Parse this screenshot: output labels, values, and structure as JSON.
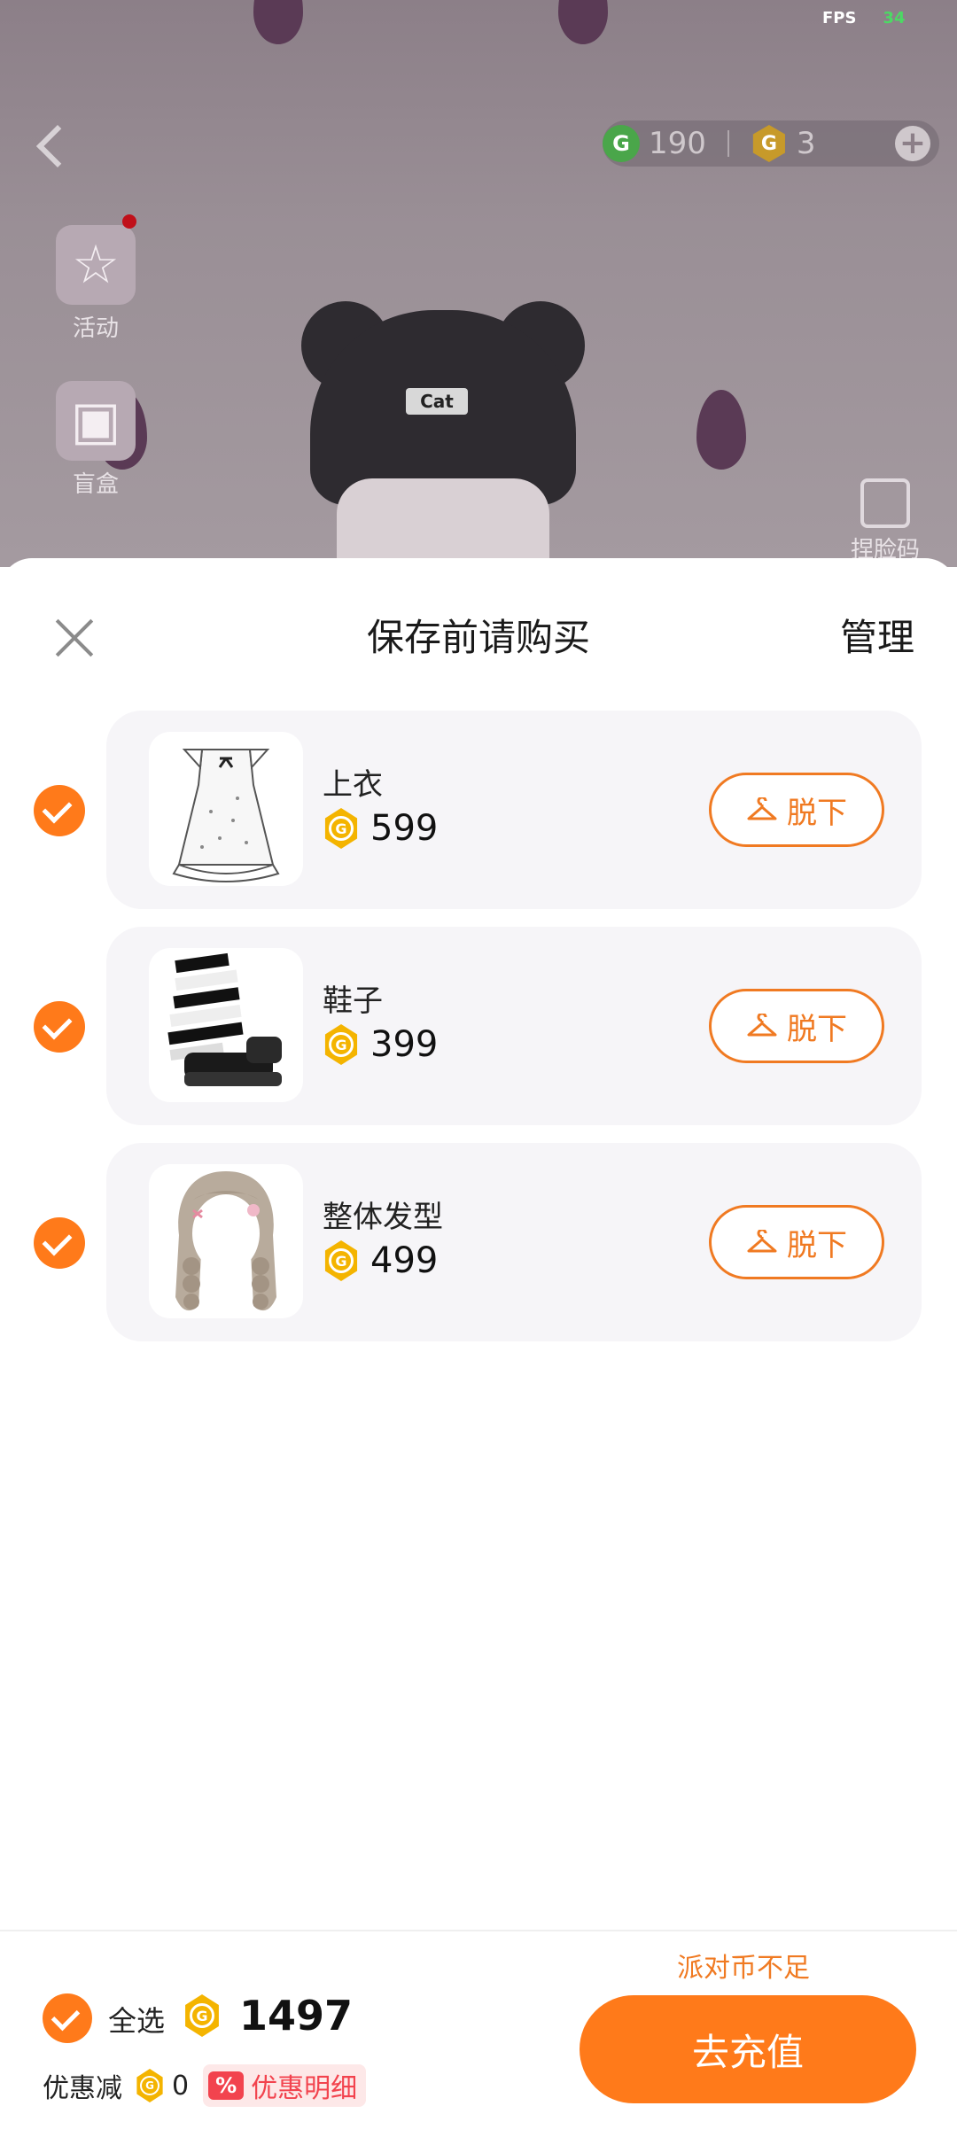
{
  "status": {
    "fps_label": "FPS",
    "fps_value": "34"
  },
  "scene": {
    "currency": {
      "green_amount": "190",
      "gold_amount": "3"
    },
    "side_menu": [
      {
        "label": "活动"
      },
      {
        "label": "盲盒"
      }
    ],
    "face_code_label": "捏脸码",
    "avatar_hat_text": "Cat"
  },
  "sheet": {
    "title": "保存前请购买",
    "manage_label": "管理",
    "items": [
      {
        "name": "上衣",
        "price": "599",
        "action": "脱下",
        "checked": true
      },
      {
        "name": "鞋子",
        "price": "399",
        "action": "脱下",
        "checked": true
      },
      {
        "name": "整体发型",
        "price": "499",
        "action": "脱下",
        "checked": true
      }
    ]
  },
  "footer": {
    "select_all_label": "全选",
    "total": "1497",
    "discount_label": "优惠减",
    "discount_value": "0",
    "discount_tag": "%",
    "discount_detail_label": "优惠明细",
    "insufficient_text": "派对币不足",
    "recharge_label": "去充值"
  },
  "colors": {
    "accent": "#ff7a1a",
    "coin": "#f4b400",
    "discount": "#f2434e"
  }
}
